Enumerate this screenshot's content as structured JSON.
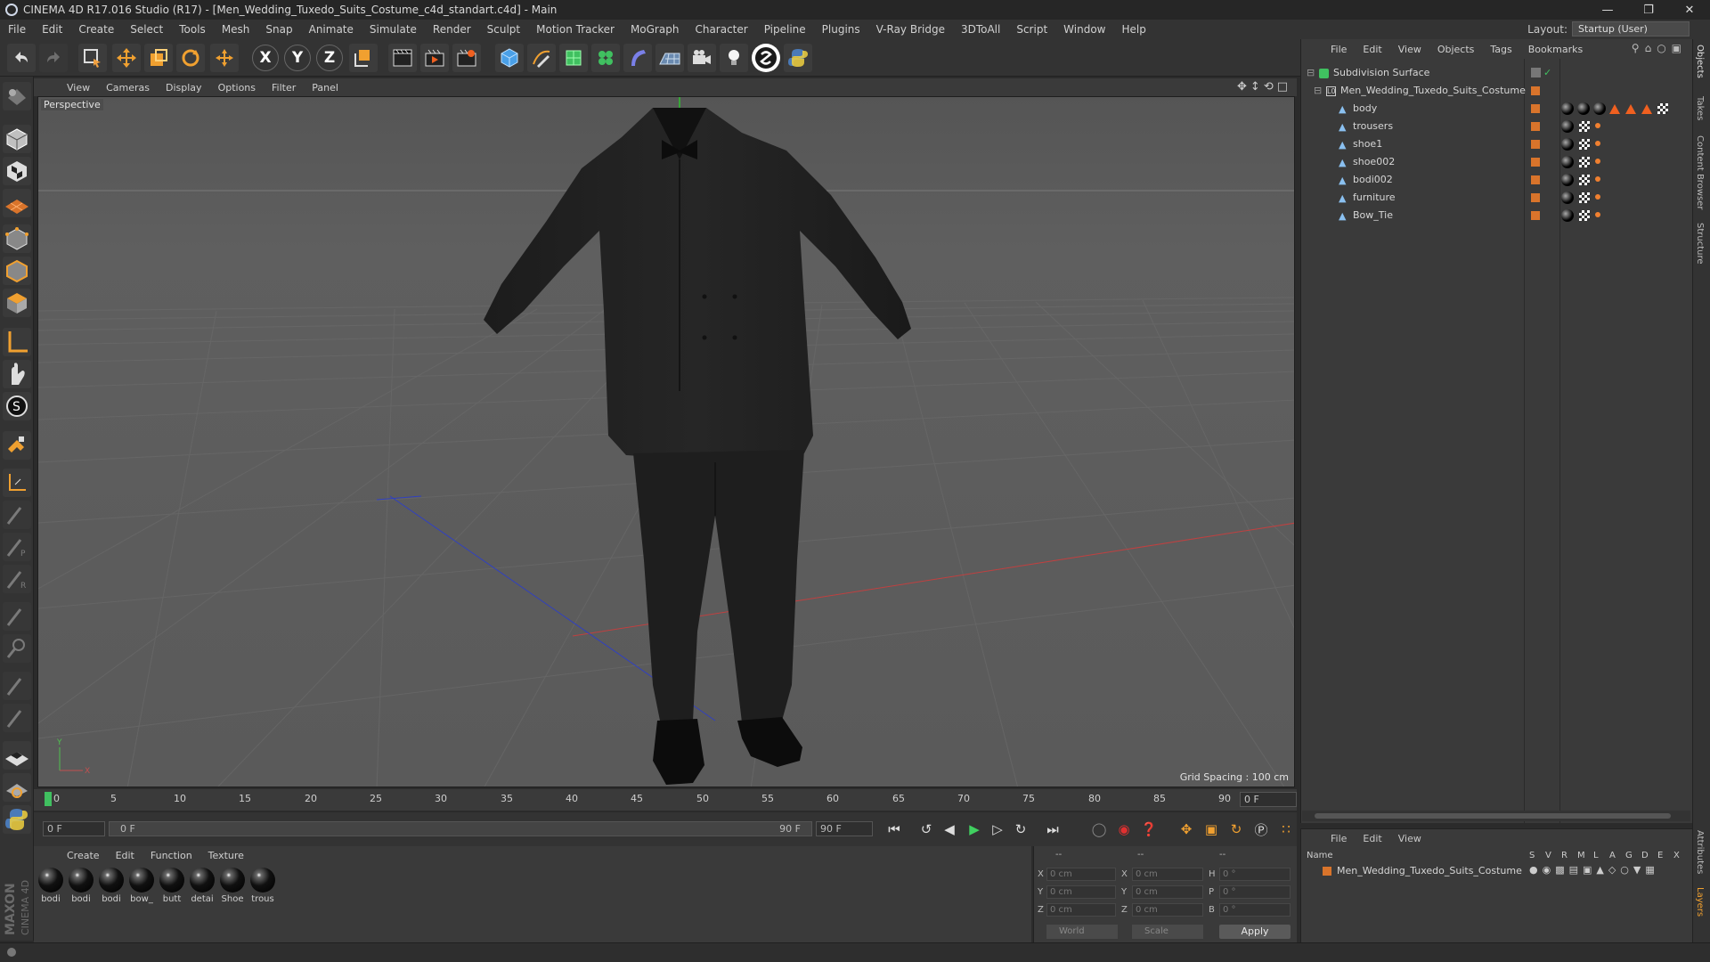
{
  "titlebar": {
    "title": "CINEMA 4D R17.016 Studio (R17) - [Men_Wedding_Tuxedo_Suits_Costume_c4d_standart.c4d] - Main"
  },
  "menubar": {
    "items": [
      "File",
      "Edit",
      "Create",
      "Select",
      "Tools",
      "Mesh",
      "Snap",
      "Animate",
      "Simulate",
      "Render",
      "Sculpt",
      "Motion Tracker",
      "MoGraph",
      "Character",
      "Pipeline",
      "Plugins",
      "V-Ray Bridge",
      "3DToAll",
      "Script",
      "Window",
      "Help"
    ],
    "layout_label": "Layout:",
    "layout_value": "Startup (User)"
  },
  "viewport": {
    "menu": [
      "View",
      "Cameras",
      "Display",
      "Options",
      "Filter",
      "Panel"
    ],
    "label": "Perspective",
    "grid_spacing": "Grid Spacing : 100 cm"
  },
  "timeline": {
    "ticks": [
      "0",
      "5",
      "10",
      "15",
      "20",
      "25",
      "30",
      "35",
      "40",
      "45",
      "50",
      "55",
      "60",
      "65",
      "70",
      "75",
      "80",
      "85",
      "90"
    ],
    "current_frame": "0 F"
  },
  "playback": {
    "start": "0 F",
    "range_start": "0 F",
    "range_end": "90 F",
    "end": "90 F"
  },
  "material_manager": {
    "menu": [
      "Create",
      "Edit",
      "Function",
      "Texture"
    ],
    "materials": [
      "bodi",
      "bodi",
      "bodi",
      "bow_",
      "butt",
      "detai",
      "Shoe",
      "trous"
    ]
  },
  "coordinates": {
    "header": [
      "--",
      "--",
      "--"
    ],
    "x": "0 cm",
    "y": "0 cm",
    "z": "0 cm",
    "sx": "0 cm",
    "sy": "0 cm",
    "sz": "0 cm",
    "h": "0 °",
    "p": "0 °",
    "b": "0 °",
    "mode": "World",
    "scale": "Scale",
    "apply": "Apply",
    "labels": {
      "x": "X",
      "y": "Y",
      "z": "Z",
      "sx": "X",
      "sy": "Y",
      "sz": "Z",
      "h": "H",
      "p": "P",
      "b": "B"
    }
  },
  "object_manager": {
    "menu": [
      "File",
      "Edit",
      "View",
      "Objects",
      "Tags",
      "Bookmarks"
    ],
    "root": "Subdivision Surface",
    "group": "Men_Wedding_Tuxedo_Suits_Costume",
    "objects": [
      "body",
      "trousers",
      "shoe1",
      "shoe002",
      "bodi002",
      "furniture",
      "Bow_Tie"
    ]
  },
  "attribute_manager": {
    "menu": [
      "File",
      "Edit",
      "View"
    ],
    "col_name": "Name",
    "cols": [
      "S",
      "V",
      "R",
      "M",
      "L",
      "A",
      "G",
      "D",
      "E",
      "X"
    ],
    "row": "Men_Wedding_Tuxedo_Suits_Costume"
  },
  "right_tabs": [
    "Objects",
    "Takes",
    "Content Browser",
    "Structure",
    "Attributes",
    "Layers"
  ],
  "colors": {
    "accent": "#d9742b",
    "viewport_bg": "#595959",
    "panel": "#3a3a3a"
  }
}
